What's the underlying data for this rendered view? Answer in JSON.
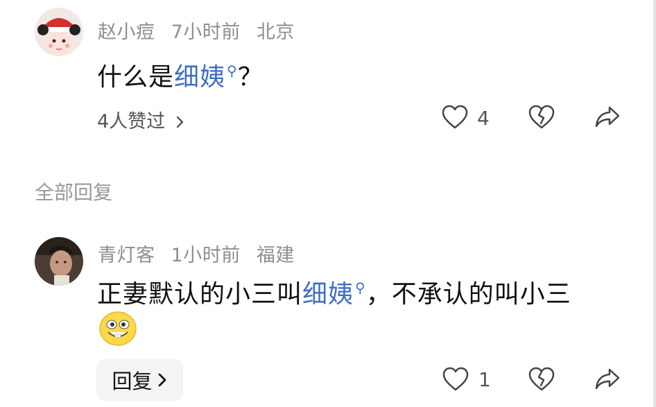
{
  "comment": {
    "author": "赵小痘",
    "time": "7小时前",
    "location": "北京",
    "text_before": "什么是",
    "link_text": "细姨",
    "text_after": "？",
    "liked_by": "4人赞过",
    "like_count": "4"
  },
  "section_title": "全部回复",
  "reply": {
    "author": "青灯客",
    "time": "1小时前",
    "location": "福建",
    "text_before": "正妻默认的小三叫",
    "link_text": "细姨",
    "text_after": "，不承认的叫小三",
    "emoji_icon": "grinning-emoji-icon",
    "reply_label": "回复",
    "like_count": "1"
  },
  "icons": {
    "like": "heart-icon",
    "dislike": "broken-heart-icon",
    "share": "share-arrow-icon",
    "search": "search-icon",
    "chevron": "chevron-right-icon"
  },
  "colors": {
    "link": "#3f6fc1",
    "meta": "#8e8e8e"
  }
}
